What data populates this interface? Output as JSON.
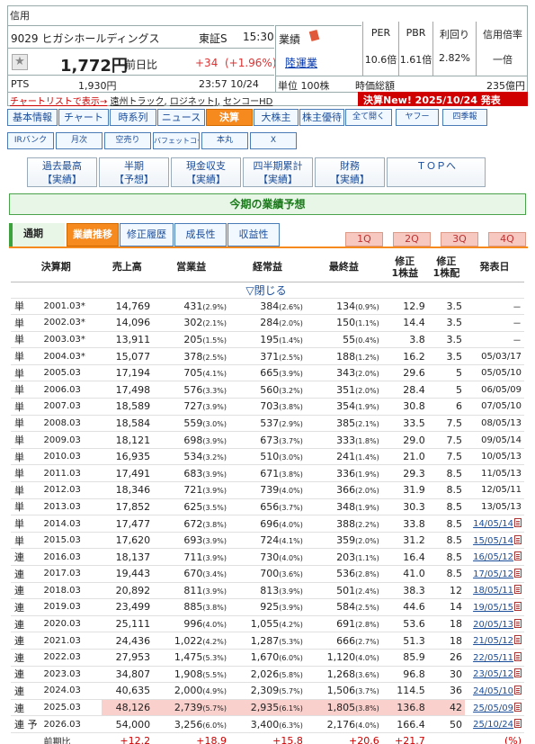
{
  "header": {
    "shinyo": "信用",
    "code": "9029",
    "name": "ヒガシホールディングス",
    "market": "東証S",
    "time": "15:30",
    "price": "1,772円",
    "zenjitsu": "前日比",
    "change": "+34",
    "change_pct": "(+1.96%)",
    "pts_label": "PTS",
    "pts_price": "1,930円",
    "pts_time": "23:57  10/24",
    "gyoseki_label": "業績",
    "sector": "陸運業",
    "unit": "単位 100株",
    "chart_list": "チャートリストで表示→",
    "related": [
      "遠州トラック",
      "ロジネットJ",
      "センコーHD"
    ],
    "ratios": [
      {
        "h": "PER",
        "v": "10.6倍"
      },
      {
        "h": "PBR",
        "v": "1.61倍"
      },
      {
        "h": "利回り",
        "v": "2.82%"
      },
      {
        "h": "信用倍率",
        "v": "一倍"
      }
    ],
    "jika_label": "時価総額",
    "jika_value": "235億円",
    "kessan": "決算New!  2025/10/24  発表"
  },
  "tabs1": [
    "基本情報",
    "チャート",
    "時系列",
    "ニュース",
    "決算",
    "大株主",
    "株主優待",
    "全て開く",
    "ヤフー",
    "四季報"
  ],
  "tabs2": [
    "IRバンク",
    "月次",
    "空売り",
    "バフェットコード",
    "本丸",
    "X"
  ],
  "tabs3": [
    [
      "過去最高",
      "【実績】"
    ],
    [
      "半期",
      "【予想】"
    ],
    [
      "現金収支",
      "【実績】"
    ],
    [
      "四半期累計",
      "【実績】"
    ],
    [
      "財務",
      "【実績】"
    ],
    [
      "ＴＯＰへ",
      ""
    ]
  ],
  "section_title": "今期の業績予想",
  "tabs4": [
    "通期",
    "業績推移",
    "修正履歴",
    "成長性",
    "収益性"
  ],
  "quarters": [
    "1Q",
    "2Q",
    "3Q",
    "4Q"
  ],
  "columns": [
    "決算期",
    "売上高",
    "営業益",
    "経常益",
    "最終益",
    "修正\n1株益",
    "修正\n1株配",
    "発表日"
  ],
  "close_label": "▽閉じる",
  "rows": [
    [
      "単",
      "2001.03*",
      "14,769",
      "431",
      "2.9",
      "384",
      "2.6",
      "134",
      "0.9",
      "12.9",
      "3.5",
      "－"
    ],
    [
      "単",
      "2002.03*",
      "14,096",
      "302",
      "2.1",
      "284",
      "2.0",
      "150",
      "1.1",
      "14.4",
      "3.5",
      "－"
    ],
    [
      "単",
      "2003.03*",
      "13,911",
      "205",
      "1.5",
      "195",
      "1.4",
      "55",
      "0.4",
      "3.8",
      "3.5",
      "－"
    ],
    [
      "単",
      "2004.03*",
      "15,077",
      "378",
      "2.5",
      "371",
      "2.5",
      "188",
      "1.2",
      "16.2",
      "3.5",
      "05/03/17"
    ],
    [
      "単",
      "2005.03",
      "17,194",
      "705",
      "4.1",
      "665",
      "3.9",
      "343",
      "2.0",
      "29.6",
      "5",
      "05/05/10"
    ],
    [
      "単",
      "2006.03",
      "17,498",
      "576",
      "3.3",
      "560",
      "3.2",
      "351",
      "2.0",
      "28.4",
      "5",
      "06/05/09"
    ],
    [
      "単",
      "2007.03",
      "18,589",
      "727",
      "3.9",
      "703",
      "3.8",
      "354",
      "1.9",
      "30.8",
      "6",
      "07/05/10"
    ],
    [
      "単",
      "2008.03",
      "18,584",
      "559",
      "3.0",
      "537",
      "2.9",
      "385",
      "2.1",
      "33.5",
      "7.5",
      "08/05/13"
    ],
    [
      "単",
      "2009.03",
      "18,121",
      "698",
      "3.9",
      "673",
      "3.7",
      "333",
      "1.8",
      "29.0",
      "7.5",
      "09/05/14"
    ],
    [
      "単",
      "2010.03",
      "16,935",
      "534",
      "3.2",
      "510",
      "3.0",
      "241",
      "1.4",
      "21.0",
      "7.5",
      "10/05/13"
    ],
    [
      "単",
      "2011.03",
      "17,491",
      "683",
      "3.9",
      "671",
      "3.8",
      "336",
      "1.9",
      "29.3",
      "8.5",
      "11/05/13"
    ],
    [
      "単",
      "2012.03",
      "18,346",
      "721",
      "3.9",
      "739",
      "4.0",
      "366",
      "2.0",
      "31.9",
      "8.5",
      "12/05/11"
    ],
    [
      "単",
      "2013.03",
      "17,852",
      "625",
      "3.5",
      "656",
      "3.7",
      "348",
      "1.9",
      "30.3",
      "8.5",
      "13/05/13"
    ],
    [
      "単",
      "2014.03",
      "17,477",
      "672",
      "3.8",
      "696",
      "4.0",
      "388",
      "2.2",
      "33.8",
      "8.5",
      "14/05/14"
    ],
    [
      "単",
      "2015.03",
      "17,620",
      "693",
      "3.9",
      "724",
      "4.1",
      "359",
      "2.0",
      "31.2",
      "8.5",
      "15/05/14"
    ],
    [
      "連",
      "2016.03",
      "18,137",
      "711",
      "3.9",
      "730",
      "4.0",
      "203",
      "1.1",
      "16.4",
      "8.5",
      "16/05/12"
    ],
    [
      "連",
      "2017.03",
      "19,443",
      "670",
      "3.4",
      "700",
      "3.6",
      "536",
      "2.8",
      "41.0",
      "8.5",
      "17/05/12"
    ],
    [
      "連",
      "2018.03",
      "20,892",
      "811",
      "3.9",
      "813",
      "3.9",
      "501",
      "2.4",
      "38.3",
      "12",
      "18/05/11"
    ],
    [
      "連",
      "2019.03",
      "23,499",
      "885",
      "3.8",
      "925",
      "3.9",
      "584",
      "2.5",
      "44.6",
      "14",
      "19/05/15"
    ],
    [
      "連",
      "2020.03",
      "25,111",
      "996",
      "4.0",
      "1,055",
      "4.2",
      "691",
      "2.8",
      "53.6",
      "18",
      "20/05/13"
    ],
    [
      "連",
      "2021.03",
      "24,436",
      "1,022",
      "4.2",
      "1,287",
      "5.3",
      "666",
      "2.7",
      "51.3",
      "18",
      "21/05/12"
    ],
    [
      "連",
      "2022.03",
      "27,953",
      "1,475",
      "5.3",
      "1,670",
      "6.0",
      "1,120",
      "4.0",
      "85.9",
      "26",
      "22/05/11"
    ],
    [
      "連",
      "2023.03",
      "34,807",
      "1,908",
      "5.5",
      "2,026",
      "5.8",
      "1,268",
      "3.6",
      "96.8",
      "30",
      "23/05/12"
    ],
    [
      "連",
      "2024.03",
      "40,635",
      "2,000",
      "4.9",
      "2,309",
      "5.7",
      "1,506",
      "3.7",
      "114.5",
      "36",
      "24/05/10"
    ],
    [
      "連",
      "2025.03",
      "48,126",
      "2,739",
      "5.7",
      "2,935",
      "6.1",
      "1,805",
      "3.8",
      "136.8",
      "42",
      "25/05/09"
    ],
    [
      "連 予",
      "2026.03",
      "54,000",
      "3,256",
      "6.0",
      "3,400",
      "6.3",
      "2,176",
      "4.0",
      "166.4",
      "50",
      "25/10/24"
    ]
  ],
  "prev_label": "前期比",
  "prev": [
    "+12.2",
    "+18.9",
    "+15.8",
    "+20.6",
    "+21.7",
    "",
    "(%)"
  ]
}
